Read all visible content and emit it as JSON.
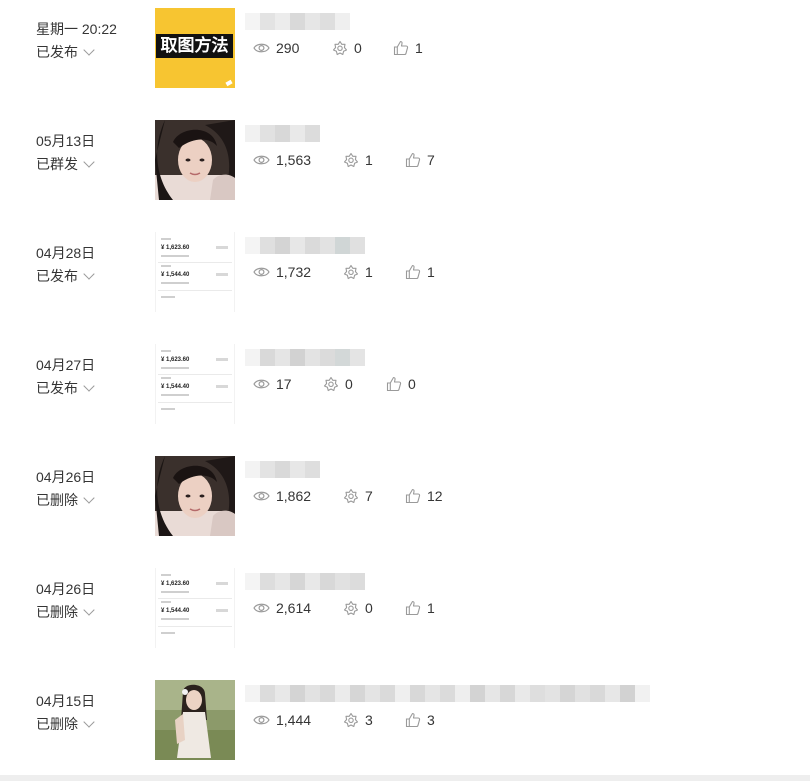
{
  "colors": {
    "text": "#353535",
    "icon": "#9a9a9a",
    "yellow": "#f7c531",
    "bottom_bar": "#eeeeee"
  },
  "icons": {
    "views": "eye-icon",
    "shares": "share-icon",
    "likes": "thumb-up-icon",
    "status": "chevron-down-icon"
  },
  "posts": [
    {
      "date": "星期一 20:22",
      "status": "已发布",
      "thumb": "yellow",
      "thumb_text": "取图方法",
      "views": "290",
      "shares": "0",
      "likes": "1"
    },
    {
      "date": "05月13日",
      "status": "已群发",
      "thumb": "girl",
      "views": "1,563",
      "shares": "1",
      "likes": "7"
    },
    {
      "date": "04月28日",
      "status": "已发布",
      "thumb": "money",
      "amount1": "¥ 1,623.60",
      "amount2": "¥ 1,544.40",
      "views": "1,732",
      "shares": "1",
      "likes": "1"
    },
    {
      "date": "04月27日",
      "status": "已发布",
      "thumb": "money",
      "amount1": "¥ 1,623.60",
      "amount2": "¥ 1,544.40",
      "views": "17",
      "shares": "0",
      "likes": "0"
    },
    {
      "date": "04月26日",
      "status": "已删除",
      "thumb": "girl",
      "views": "1,862",
      "shares": "7",
      "likes": "12"
    },
    {
      "date": "04月26日",
      "status": "已删除",
      "thumb": "money",
      "amount1": "¥ 1,623.60",
      "amount2": "¥ 1,544.40",
      "views": "2,614",
      "shares": "0",
      "likes": "1"
    },
    {
      "date": "04月15日",
      "status": "已删除",
      "thumb": "girl-field",
      "views": "1,444",
      "shares": "3",
      "likes": "3"
    }
  ]
}
